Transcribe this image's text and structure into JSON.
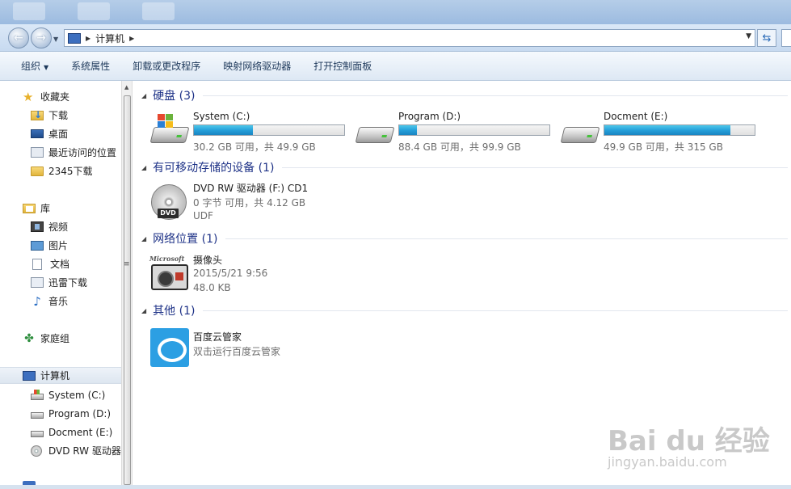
{
  "address": {
    "crumb": "计算机"
  },
  "toolbar": {
    "organize": "组织",
    "system_properties": "系统属性",
    "uninstall": "卸载或更改程序",
    "map_drive": "映射网络驱动器",
    "control_panel": "打开控制面板"
  },
  "nav": {
    "favorites": "收藏夹",
    "downloads": "下载",
    "desktop": "桌面",
    "recent": "最近访问的位置",
    "dl2345": "2345下载",
    "libraries": "库",
    "videos": "视频",
    "pictures": "图片",
    "documents": "文档",
    "xunlei": "迅雷下载",
    "music": "音乐",
    "homegroup": "家庭组",
    "computer": "计算机",
    "drive_c": "System (C:)",
    "drive_d": "Program (D:)",
    "drive_e": "Docment (E:)",
    "drive_f": "DVD RW 驱动器"
  },
  "groups": {
    "hdd": "硬盘 (3)",
    "removable": "有可移动存储的设备 (1)",
    "network": "网络位置 (1)",
    "other": "其他 (1)"
  },
  "drives": [
    {
      "name": "System (C:)",
      "info": "30.2 GB 可用，共 49.9 GB",
      "used_fraction": 0.39
    },
    {
      "name": "Program (D:)",
      "info": "88.4 GB 可用，共 99.9 GB",
      "used_fraction": 0.12
    },
    {
      "name": "Docment (E:)",
      "info": "49.9 GB 可用，共 315 GB",
      "used_fraction": 0.84
    }
  ],
  "dvd": {
    "name": "DVD RW 驱动器 (F:) CD1",
    "info": "0 字节 可用，共 4.12 GB",
    "fs": "UDF",
    "tag": "DVD"
  },
  "camera": {
    "name": "摄像头",
    "date": "2015/5/21 9:56",
    "size": "48.0 KB",
    "brand": "Microsoft"
  },
  "baidu": {
    "name": "百度云管家",
    "desc": "双击运行百度云管家"
  },
  "watermark": {
    "logo": "Bai du 经验",
    "url": "jingyan.baidu.com"
  },
  "colors": {
    "bar_fill": "#26a0da",
    "group_title": "#1e3287"
  }
}
